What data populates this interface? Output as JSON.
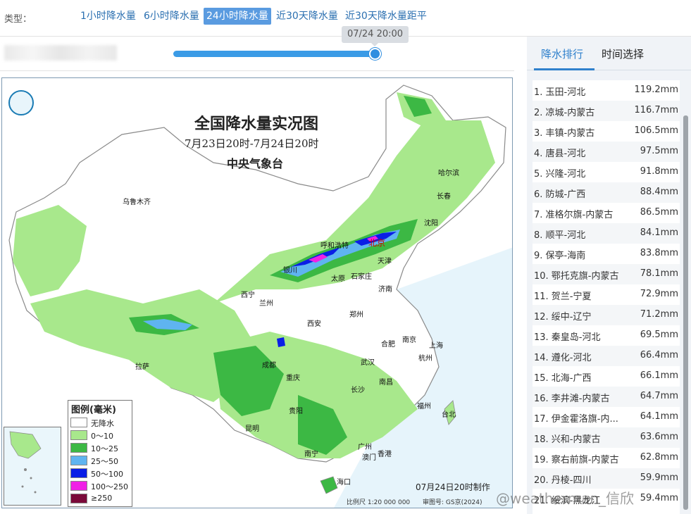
{
  "typebar": {
    "label": "类型：",
    "tabs": [
      {
        "label": "1小时降水量",
        "active": false
      },
      {
        "label": "6小时降水量",
        "active": false
      },
      {
        "label": "24小时降水量",
        "active": true
      },
      {
        "label": "近30天降水量",
        "active": false
      },
      {
        "label": "近30天降水量距平",
        "active": false
      }
    ]
  },
  "slider": {
    "tooltip": "07/24 20:00",
    "position_fraction": 1.0
  },
  "map": {
    "title": "全国降水量实况图",
    "subtitle": "7月23日20时-7月24日20时",
    "agency": "中央气象台",
    "produced": "07月24日20时制作",
    "scale": "比例尺  1:20 000 000",
    "review_no": "审图号: GS京(2024)",
    "cities": {
      "urumqi": "乌鲁木齐",
      "harbin": "哈尔滨",
      "changchun": "长春",
      "shenyang": "沈阳",
      "hohhot": "呼和浩特",
      "beijing": "北京",
      "tianjin": "天津",
      "yinchuan": "银川",
      "taiyuan": "太原",
      "shijiazhuang": "石家庄",
      "jinan": "济南",
      "xining": "西宁",
      "lanzhou": "兰州",
      "zhengzhou": "郑州",
      "xian": "西安",
      "hefei": "合肥",
      "nanjing": "南京",
      "shanghai": "上海",
      "lhasa": "拉萨",
      "chengdu": "成都",
      "wuhan": "武汉",
      "hangzhou": "杭州",
      "chongqing": "重庆",
      "nanchang": "南昌",
      "changsha": "长沙",
      "guiyang": "贵阳",
      "fuzhou": "福州",
      "taibei": "台北",
      "kunming": "昆明",
      "guangzhou": "广州",
      "nanning": "南宁",
      "hongkong": "香港",
      "macau": "澳门",
      "haikou": "海口"
    },
    "legend": {
      "title": "图例(毫米)",
      "items": [
        {
          "label": "无降水",
          "color": "#ffffff"
        },
        {
          "label": "0～10",
          "color": "#a8e88c"
        },
        {
          "label": "10～25",
          "color": "#3cb844"
        },
        {
          "label": "25～50",
          "color": "#5fb4f0"
        },
        {
          "label": "50～100",
          "color": "#0a1ee6"
        },
        {
          "label": "100～250",
          "color": "#f020e6"
        },
        {
          "label": "≥250",
          "color": "#7a0a3a"
        }
      ]
    }
  },
  "panel": {
    "tabs": [
      {
        "label": "降水排行",
        "active": true
      },
      {
        "label": "时间选择",
        "active": false
      }
    ],
    "ranking": [
      {
        "name": "1. 玉田-河北",
        "value": "119.2mm"
      },
      {
        "name": "2. 凉城-内蒙古",
        "value": "116.7mm"
      },
      {
        "name": "3. 丰镇-内蒙古",
        "value": "106.5mm"
      },
      {
        "name": "4. 唐县-河北",
        "value": "97.5mm"
      },
      {
        "name": "5. 兴隆-河北",
        "value": "91.8mm"
      },
      {
        "name": "6. 防城-广西",
        "value": "88.4mm"
      },
      {
        "name": "7. 准格尔旗-内蒙古",
        "value": "86.5mm"
      },
      {
        "name": "8. 顺平-河北",
        "value": "84.1mm"
      },
      {
        "name": "9. 保亭-海南",
        "value": "83.8mm"
      },
      {
        "name": "10. 鄂托克旗-内蒙古",
        "value": "78.1mm"
      },
      {
        "name": "11. 贺兰-宁夏",
        "value": "72.9mm"
      },
      {
        "name": "12. 绥中-辽宁",
        "value": "71.2mm"
      },
      {
        "name": "13. 秦皇岛-河北",
        "value": "69.5mm"
      },
      {
        "name": "14. 遵化-河北",
        "value": "66.4mm"
      },
      {
        "name": "15. 北海-广西",
        "value": "66.1mm"
      },
      {
        "name": "16. 李井滩-内蒙古",
        "value": "64.7mm"
      },
      {
        "name": "17. 伊金霍洛旗-内...",
        "value": "64.1mm"
      },
      {
        "name": "18. 兴和-内蒙古",
        "value": "63.6mm"
      },
      {
        "name": "19. 察右前旗-内蒙古",
        "value": "62.8mm"
      },
      {
        "name": "20. 丹棱-四川",
        "value": "59.9mm"
      },
      {
        "name": "21. 绥滨-黑龙江",
        "value": "59.4mm"
      }
    ]
  },
  "watermark": "@weatherman_信欣"
}
